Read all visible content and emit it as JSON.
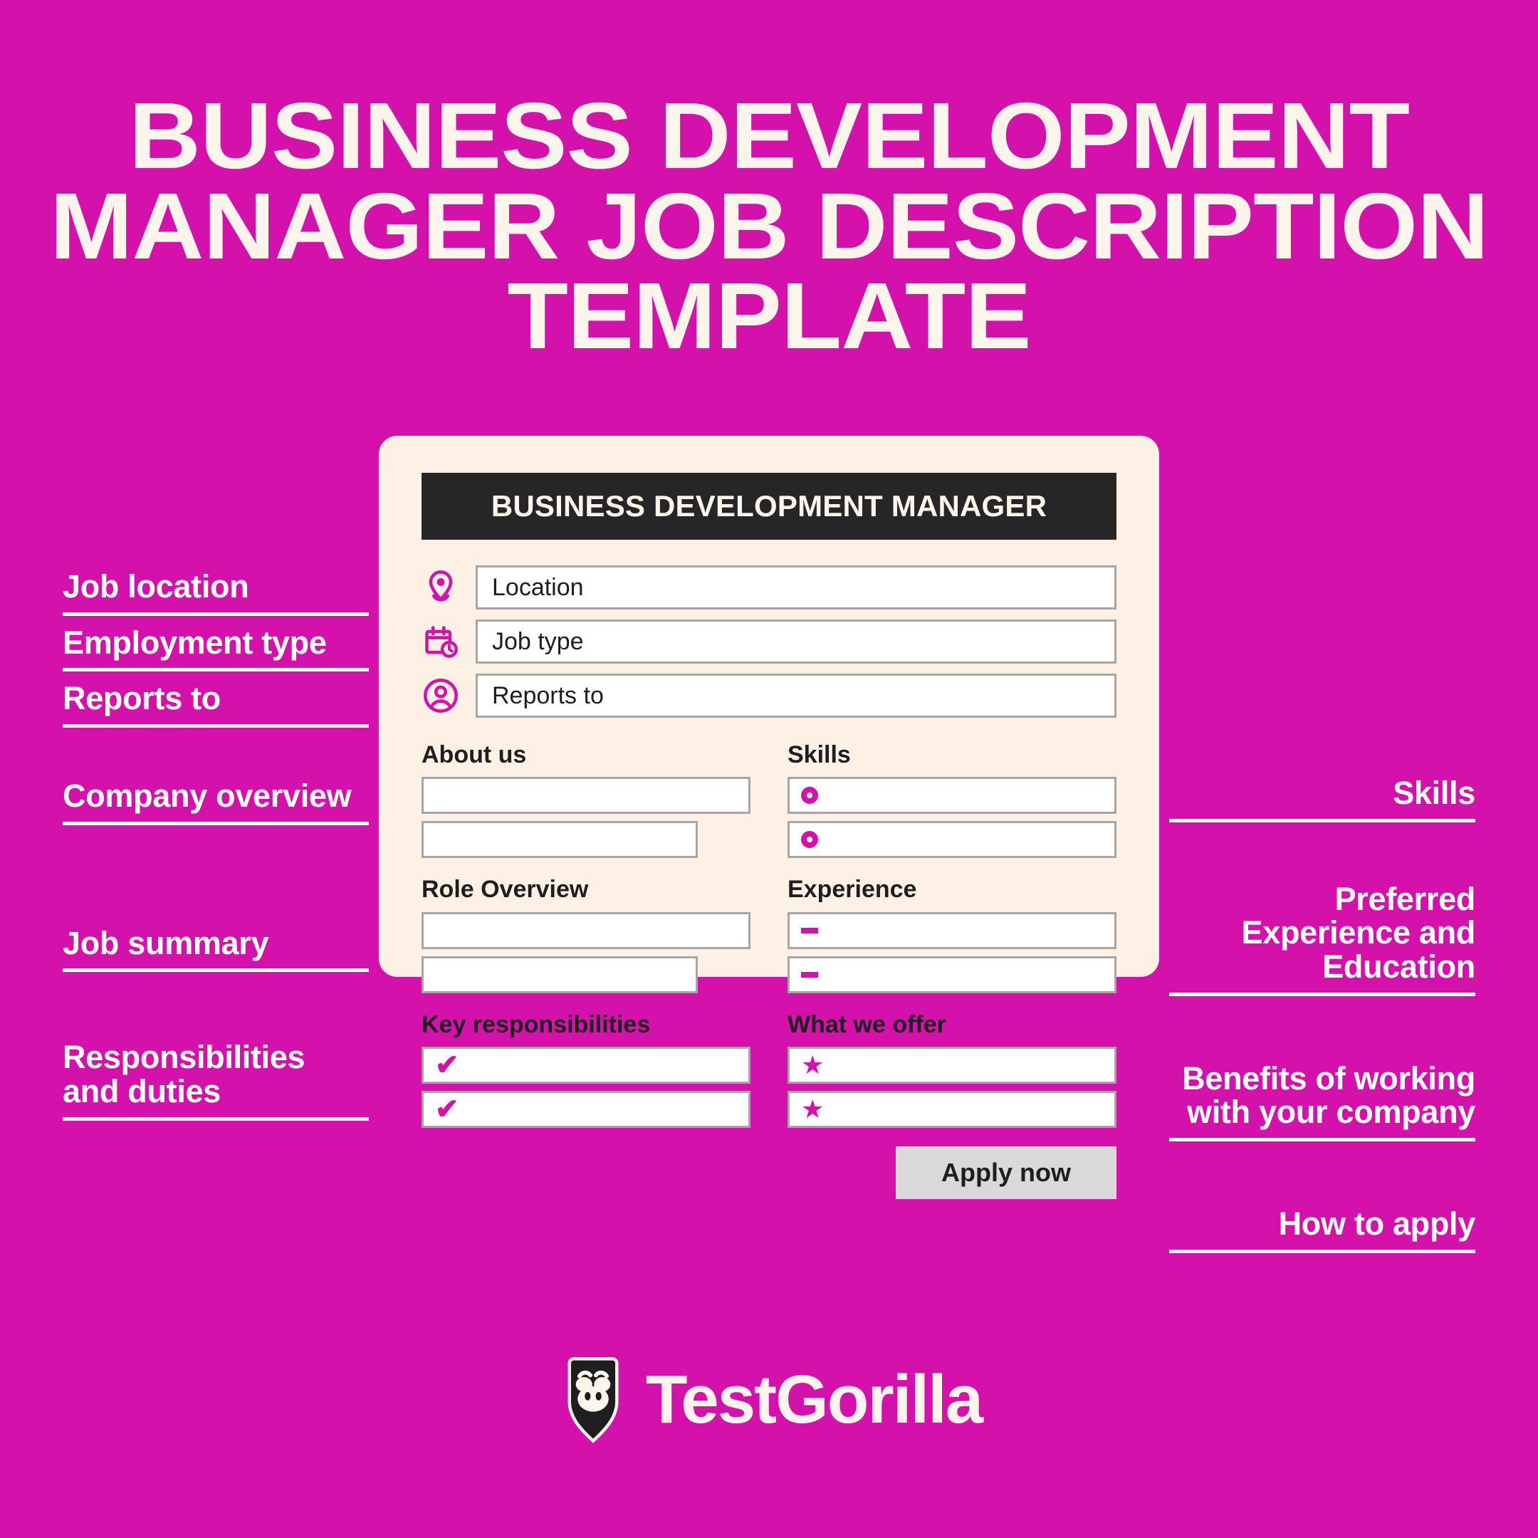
{
  "page": {
    "title": "BUSINESS DEVELOPMENT MANAGER JOB DESCRIPTION TEMPLATE",
    "background_color": "#D411AB",
    "accent_color": "#D411AB",
    "card_color": "#FDF1E6",
    "text_light": "#FDF4EB",
    "text_dark": "#1E1E1E"
  },
  "card": {
    "header": "BUSINESS DEVELOPMENT MANAGER",
    "top_rows": [
      {
        "icon": "location-pin-icon",
        "value": "Location"
      },
      {
        "icon": "calendar-clock-icon",
        "value": "Job type"
      },
      {
        "icon": "person-circle-icon",
        "value": "Reports to"
      }
    ],
    "left_column": [
      {
        "label": "About us",
        "marker": "none",
        "rows": 2
      },
      {
        "label": "Role Overview",
        "marker": "none",
        "rows": 2
      },
      {
        "label": "Key responsibilities",
        "marker": "check",
        "rows": 2
      }
    ],
    "right_column": [
      {
        "label": "Skills",
        "marker": "ring",
        "rows": 2
      },
      {
        "label": "Experience",
        "marker": "dash",
        "rows": 2
      },
      {
        "label": "What we offer",
        "marker": "star",
        "rows": 2
      }
    ],
    "apply_button": "Apply now"
  },
  "side_left": [
    {
      "label": "Job location"
    },
    {
      "label": "Employment type"
    },
    {
      "label": "Reports to"
    },
    {
      "label": "Company overview"
    },
    {
      "label": "Job summary"
    },
    {
      "label": "Responsibilities and duties"
    }
  ],
  "side_right": [
    {
      "label": "Skills"
    },
    {
      "label": "Preferred Experience and Education"
    },
    {
      "label": "Benefits of working with your company"
    },
    {
      "label": "How to apply"
    }
  ],
  "footer": {
    "brand": "TestGorilla",
    "logo_icon": "gorilla-shield-logo-icon"
  }
}
